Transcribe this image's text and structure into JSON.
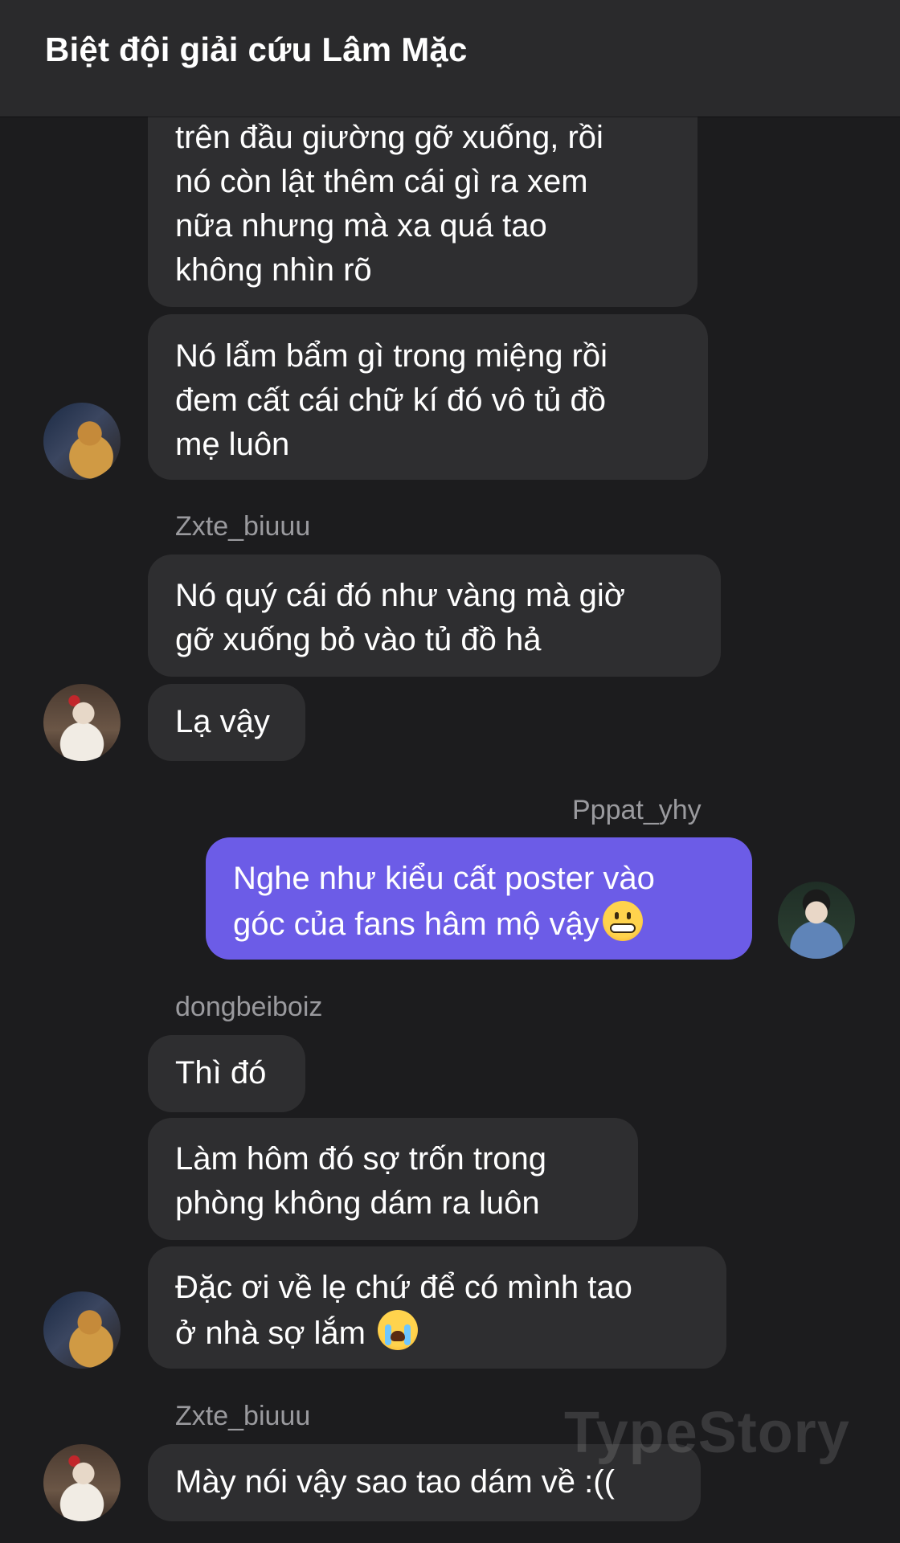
{
  "header": {
    "title": "Biệt đội giải cứu Lâm Mặc"
  },
  "messages": [
    {
      "text": "trên đầu giường gỡ xuống, rồi\nnó còn lật thêm cái gì ra xem\nnữa nhưng mà xa quá tao\nkhông nhìn rõ"
    },
    {
      "text": "Nó lẩm bẩm gì trong miệng rồi\nđem cất cái chữ kí đó vô tủ đồ\nmẹ luôn"
    },
    {
      "sender": "Zxte_biuuu"
    },
    {
      "text": "Nó quý cái đó như vàng mà giờ\ngỡ xuống bỏ vào tủ đồ hả"
    },
    {
      "text": "Lạ vậy"
    },
    {
      "sender": "Pppat_yhy"
    },
    {
      "text_line1": "Nghe như kiểu cất poster vào",
      "text_line2": "góc của fans hâm mộ vậy",
      "emoji": "grimacing-face-emoji"
    },
    {
      "sender": "dongbeiboiz"
    },
    {
      "text": "Thì đó"
    },
    {
      "text": "Làm hôm đó sợ trốn trong\nphòng không dám ra luôn"
    },
    {
      "text_line1": "Đặc ơi về lẹ chứ để có mình tao",
      "text_line2": "ở nhà sợ lắm ",
      "emoji": "crying-face-emoji"
    },
    {
      "sender": "Zxte_biuuu"
    },
    {
      "text": "Mày nói vậy sao tao dám về :(("
    }
  ],
  "colors": {
    "background": "#1c1c1e",
    "bubble": "#2e2e30",
    "my_bubble": "#6c5ce7",
    "sender_name": "#9a9a9e"
  },
  "watermark": "TypeStory"
}
